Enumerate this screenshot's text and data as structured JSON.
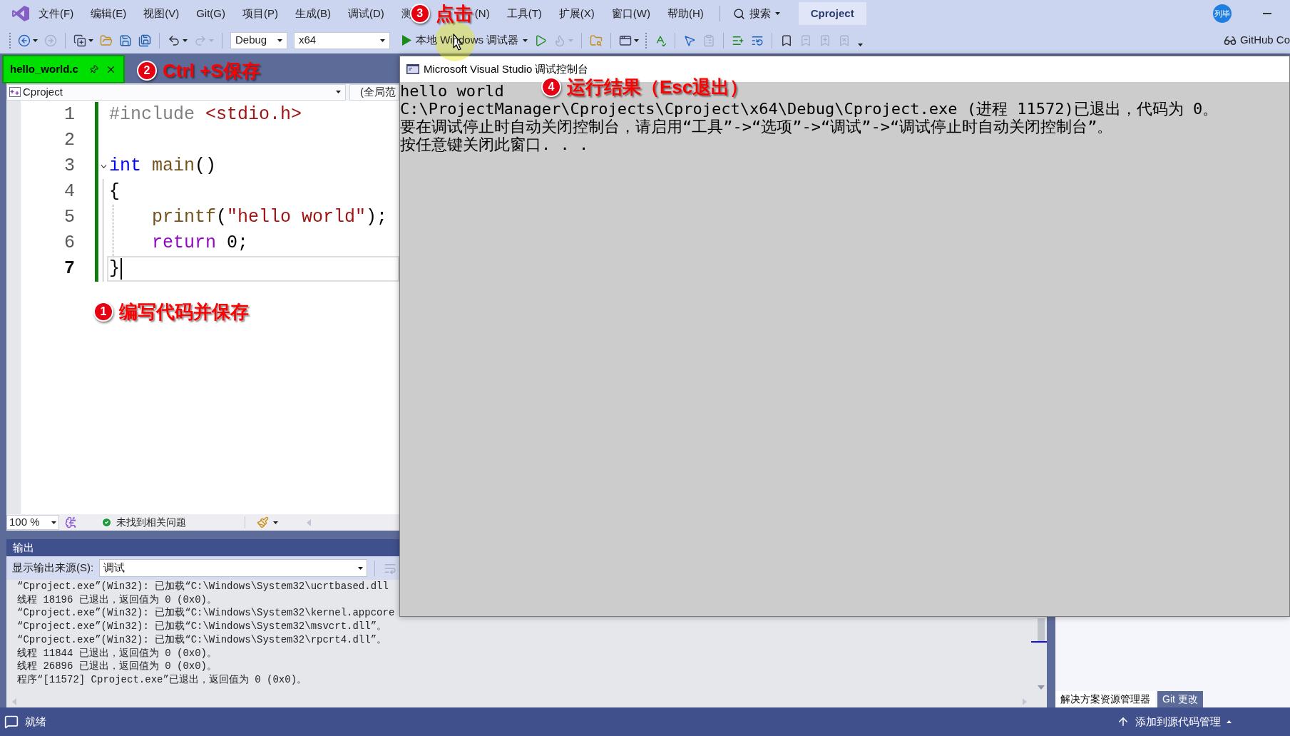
{
  "menu_bar": {
    "items": [
      {
        "kind": "menu",
        "label": "文件(F)"
      },
      {
        "kind": "menu",
        "label": "编辑(E)"
      },
      {
        "kind": "menu",
        "label": "视图(V)"
      },
      {
        "kind": "menu",
        "label": "Git(G)"
      },
      {
        "kind": "menu",
        "label": "项目(P)"
      },
      {
        "kind": "menu",
        "label": "生成(B)"
      },
      {
        "kind": "menu",
        "label": "调试(D)"
      },
      {
        "kind": "menu",
        "label": "测"
      },
      {
        "kind": "callout",
        "number": "3",
        "text": "点击"
      },
      {
        "kind": "menu",
        "label": "(N)"
      },
      {
        "kind": "menu",
        "label": "工具(T)"
      },
      {
        "kind": "menu",
        "label": "扩展(X)"
      },
      {
        "kind": "menu",
        "label": "窗口(W)"
      },
      {
        "kind": "menu",
        "label": "帮助(H)"
      }
    ],
    "search": {
      "label": "搜索"
    },
    "solution": "Cproject",
    "account": {
      "initials": "列毕"
    }
  },
  "toolbar": {
    "items": [
      {
        "kind": "grip"
      },
      {
        "kind": "icon",
        "disabled": false,
        "menu": true
      },
      {
        "kind": "icon",
        "disabled": true
      },
      {
        "kind": "separator"
      },
      {
        "kind": "icon",
        "disabled": false,
        "menu": true
      },
      {
        "kind": "icon",
        "disabled": false
      },
      {
        "kind": "icon",
        "disabled": false
      },
      {
        "kind": "icon",
        "disabled": false
      },
      {
        "kind": "separator"
      },
      {
        "kind": "icon",
        "disabled": false,
        "menu": true
      },
      {
        "kind": "icon",
        "disabled": true,
        "menu": true
      },
      {
        "kind": "separator"
      },
      {
        "kind": "combo",
        "value": "Debug"
      },
      {
        "kind": "combo",
        "value": "x64"
      },
      {
        "kind": "run",
        "label": "本地 Windows 调试器"
      },
      {
        "kind": "icon",
        "disabled": false
      },
      {
        "kind": "icon",
        "disabled": true,
        "menu": true
      },
      {
        "kind": "separator"
      },
      {
        "kind": "icon",
        "disabled": false
      },
      {
        "kind": "separator"
      },
      {
        "kind": "icon",
        "disabled": false,
        "menu": true
      },
      {
        "kind": "grip"
      },
      {
        "kind": "icon",
        "disabled": false
      },
      {
        "kind": "separator"
      },
      {
        "kind": "icon",
        "disabled": false
      },
      {
        "kind": "icon",
        "disabled": true
      },
      {
        "kind": "separator"
      },
      {
        "kind": "icon",
        "disabled": false
      },
      {
        "kind": "icon",
        "disabled": false
      },
      {
        "kind": "separator"
      },
      {
        "kind": "icon",
        "disabled": false
      },
      {
        "kind": "icon",
        "disabled": true
      },
      {
        "kind": "icon",
        "disabled": true
      },
      {
        "kind": "icon",
        "disabled": true
      },
      {
        "kind": "overflow"
      }
    ],
    "github": {
      "label": "GitHub Co"
    }
  },
  "tab_strip": {
    "tabs": [
      {
        "label": "hello_world.c",
        "selected": true
      }
    ],
    "callout": {
      "number": "2",
      "text": "Ctrl +S保存"
    }
  },
  "editor": {
    "navigation": {
      "project": "Cproject",
      "scope": "(全局范"
    },
    "changes_saved": true,
    "lines": [
      {
        "number": "1",
        "current": false,
        "foldable": false,
        "tokens": [
          {
            "text": "#include",
            "kind": "preprocessor"
          },
          {
            "text": " <stdio.h>",
            "kind": "include_path"
          }
        ]
      },
      {
        "number": "2",
        "current": false,
        "foldable": false
      },
      {
        "number": "3",
        "current": false,
        "foldable": true,
        "tokens": [
          {
            "text": "int",
            "kind": "keyword"
          },
          {
            "text": " main",
            "kind": "function"
          },
          {
            "text": "()",
            "kind": "punct"
          }
        ]
      },
      {
        "number": "4",
        "current": false,
        "foldable": false,
        "tokens": [
          {
            "text": "{",
            "kind": "punct"
          }
        ]
      },
      {
        "number": "5",
        "current": false,
        "foldable": false,
        "tokens": [
          {
            "text": "    printf",
            "kind": "function"
          },
          {
            "text": "(",
            "kind": "punct"
          },
          {
            "text": "\"hello world\"",
            "kind": "string"
          },
          {
            "text": ");",
            "kind": "punct"
          }
        ]
      },
      {
        "number": "6",
        "current": false,
        "foldable": false,
        "tokens": [
          {
            "text": "    return",
            "kind": "control"
          },
          {
            "text": " 0;",
            "kind": "punct"
          }
        ]
      },
      {
        "number": "7",
        "current": true,
        "foldable": false,
        "tokens": [
          {
            "text": "}",
            "kind": "punct"
          }
        ]
      }
    ],
    "callout": {
      "number": "1",
      "text": "编写代码并保存"
    },
    "status": {
      "zoom": "100 %",
      "issues": "未找到相关问题"
    }
  },
  "output": {
    "title": "输出",
    "source_label": "显示输出来源(S):",
    "source": "调试",
    "wrap_button": {
      "disabled": true
    },
    "lines": [
      "“Cproject.exe”(Win32): 已加载“C:\\Windows\\System32\\ucrtbased.dll",
      "线程 18196 已退出，返回值为 0 (0x0)。",
      "“Cproject.exe”(Win32): 已加载“C:\\Windows\\System32\\kernel.appcore",
      "“Cproject.exe”(Win32): 已加载“C:\\Windows\\System32\\msvcrt.dll”。",
      "“Cproject.exe”(Win32): 已加载“C:\\Windows\\System32\\rpcrt4.dll”。",
      "线程 11844 已退出，返回值为 0 (0x0)。",
      "线程 26896 已退出，返回值为 0 (0x0)。",
      "程序“[11572] Cproject.exe”已退出，返回值为 0 (0x0)。"
    ]
  },
  "solution_panel": {
    "tabs": [
      {
        "label": "解决方案资源管理器",
        "selected": true
      },
      {
        "label": "Git 更改",
        "selected": false
      }
    ]
  },
  "status_bar": {
    "text": "就绪",
    "source_control": "添加到源代码管理"
  },
  "console": {
    "title": "Microsoft Visual Studio 调试控制台",
    "callout": {
      "number": "4",
      "text": "运行结果（Esc退出）"
    },
    "lines": [
      "hello world",
      "C:\\ProjectManager\\Cprojects\\Cproject\\x64\\Debug\\Cproject.exe (进程 11572)已退出，代码为 0。",
      "要在调试停止时自动关闭控制台，请启用“工具”->“选项”->“调试”->“调试停止时自动关闭控制台”。",
      "按任意键关闭此窗口. . ."
    ]
  }
}
